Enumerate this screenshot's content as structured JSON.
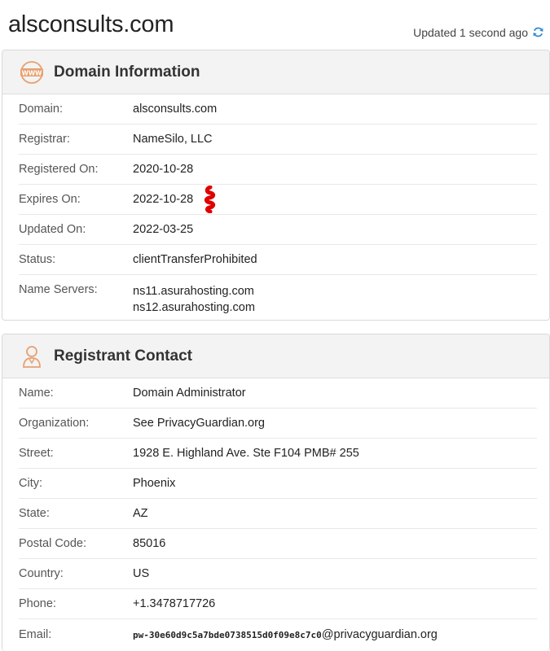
{
  "header": {
    "domain_title": "alsconsults.com",
    "updated_text": "Updated 1 second ago"
  },
  "domain_info": {
    "title": "Domain Information",
    "rows": [
      {
        "label": "Domain:",
        "value": "alsconsults.com"
      },
      {
        "label": "Registrar:",
        "value": "NameSilo, LLC"
      },
      {
        "label": "Registered On:",
        "value": "2020-10-28"
      },
      {
        "label": "Expires On:",
        "value": "2022-10-28"
      },
      {
        "label": "Updated On:",
        "value": "2022-03-25"
      },
      {
        "label": "Status:",
        "value": "clientTransferProhibited"
      }
    ],
    "name_servers": {
      "label": "Name Servers:",
      "values": [
        "ns11.asurahosting.com",
        "ns12.asurahosting.com"
      ]
    }
  },
  "registrant": {
    "title": "Registrant Contact",
    "rows": [
      {
        "label": "Name:",
        "value": "Domain Administrator"
      },
      {
        "label": "Organization:",
        "value": "See PrivacyGuardian.org"
      },
      {
        "label": "Street:",
        "value": "1928 E. Highland Ave. Ste F104 PMB# 255"
      },
      {
        "label": "City:",
        "value": "Phoenix"
      },
      {
        "label": "State:",
        "value": "AZ"
      },
      {
        "label": "Postal Code:",
        "value": "85016"
      },
      {
        "label": "Country:",
        "value": "US"
      },
      {
        "label": "Phone:",
        "value": "+1.3478717726"
      }
    ],
    "email": {
      "label": "Email:",
      "user": "pw-30e60d9c5a7bde0738515d0f09e8c7c0",
      "domain": "@privacyguardian.org"
    }
  },
  "colors": {
    "icon_accent": "#e8a170",
    "refresh_icon": "#2f8ad4",
    "annotation_mark": "#e00000"
  }
}
